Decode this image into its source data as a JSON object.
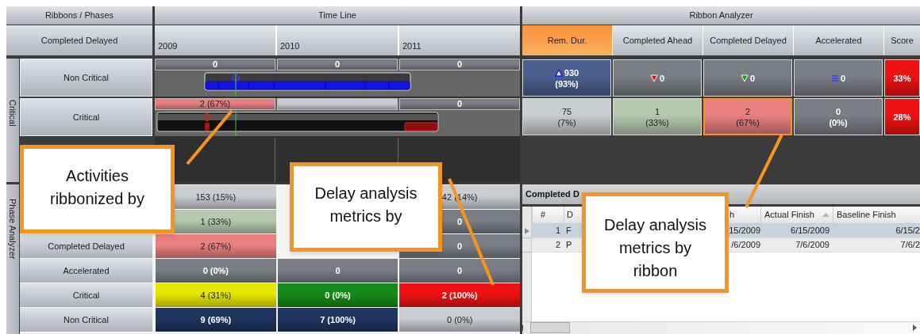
{
  "column_headers": {
    "ribbons_phases": "Ribbons / Phases",
    "time_line": "Time Line",
    "ribbon_analyzer": "Ribbon Analyzer"
  },
  "metric": "Completed Delayed",
  "years": [
    "2009",
    "2010",
    "2011"
  ],
  "analyzer_columns": [
    {
      "label": "Rem. Dur.",
      "selected": true
    },
    {
      "label": "Completed Ahead",
      "selected": false
    },
    {
      "label": "Completed Delayed",
      "selected": false
    },
    {
      "label": "Accelerated",
      "selected": false
    },
    {
      "label": "Score",
      "selected": false
    }
  ],
  "ribbon_group": "Critical",
  "ribbons": [
    {
      "label": "Non Critical",
      "kind": "noncritical",
      "periods": [
        {
          "text": "0",
          "color": "#7a7d84"
        },
        {
          "text": "0",
          "color": "#7a7d84"
        },
        {
          "text": "0",
          "color": "#7a7d84"
        }
      ],
      "metrics": [
        {
          "kind": "up",
          "value": "930",
          "share": "(93%)",
          "color": "#4a5f8e",
          "selected": false
        },
        {
          "kind": "down",
          "value": "0",
          "color": "#7a7d84",
          "selected": false
        },
        {
          "kind": "downgreen",
          "value": "0",
          "color": "#7a7d84",
          "selected": false
        },
        {
          "kind": "equal",
          "value": "0",
          "color": "#7a7d84",
          "selected": false
        },
        {
          "kind": "plain",
          "value": "33%",
          "color": "#ee1111",
          "selected": false
        }
      ]
    },
    {
      "label": "Critical",
      "kind": "critical",
      "periods": [
        {
          "text": "2 (67%)",
          "color": "#e88080"
        },
        {
          "color": "#c9ccd1"
        },
        {
          "text": "0",
          "color": "#7a7d84"
        }
      ],
      "metrics": [
        {
          "kind": "plain",
          "value": "75",
          "share": "(7%)",
          "color": "#c9ccd1",
          "selected": false
        },
        {
          "kind": "plain",
          "value": "1",
          "share": "(33%)",
          "color": "#b5c9ae",
          "selected": false
        },
        {
          "kind": "plain",
          "value": "2",
          "share": "(67%)",
          "color": "#e88080",
          "selected": true
        },
        {
          "kind": "plain",
          "value": "0",
          "share": "(0%)",
          "color": "#7a7d84",
          "selected": false
        },
        {
          "kind": "plain",
          "value": "28%",
          "color": "#ee1111",
          "selected": false
        }
      ]
    }
  ],
  "phase_analyzer": {
    "title": "Phase Analyzer",
    "rows": [
      {
        "cells": [
          {
            "text": "153 (15%)",
            "color": "#c9ccd1"
          },
          null,
          {
            "text": "42 (14%)",
            "color": "#c9ccd1"
          }
        ]
      },
      {
        "cells": [
          {
            "text": "1 (33%)",
            "color": "#b5c9ae"
          },
          null,
          {
            "text": "0",
            "color": "#7a7d84"
          }
        ]
      },
      {
        "label": "Completed Delayed",
        "cells": [
          {
            "text": "2 (67%)",
            "color": "#e88080"
          },
          null,
          {
            "text": "0",
            "color": "#7a7d84"
          }
        ]
      },
      {
        "label": "Accelerated",
        "cells": [
          {
            "text": "0 (0%)",
            "color": "#7a7d84"
          },
          {
            "text": "0",
            "color": "#7a7d84"
          },
          {
            "text": "0",
            "color": "#7a7d84"
          }
        ]
      },
      {
        "label": "Critical",
        "cells": [
          {
            "text": "4 (31%)",
            "color": "#e6e600"
          },
          {
            "text": "0 (0%)",
            "color": "#168a16"
          },
          {
            "text": "2 (100%)",
            "color": "#ee1111"
          }
        ]
      },
      {
        "label": "Non Critical",
        "cells": [
          {
            "text": "9 (69%)",
            "color": "#1f355f"
          },
          {
            "text": "7 (100%)",
            "color": "#1f355f"
          },
          {
            "text": "0 (0%)",
            "color": "#c9ccd1"
          }
        ]
      }
    ]
  },
  "details_panel": {
    "title": "Completed D",
    "columns": [
      {
        "label": "#",
        "sorted": false
      },
      {
        "label": "D"
      },
      {
        "label": "h"
      },
      {
        "label": "Actual Finish",
        "sorted": true
      },
      {
        "label": "Baseline Finish",
        "sorted": false
      }
    ],
    "rows": [
      {
        "selected": true,
        "cells": [
          "1",
          "F",
          "15/2009",
          "6/15/2009",
          "6/15/2"
        ]
      },
      {
        "selected": false,
        "cells": [
          "2",
          "P",
          "/6/2009",
          "7/6/2009",
          "7/6/2"
        ]
      }
    ]
  },
  "callouts": [
    {
      "text": "Activities ribbonized by"
    },
    {
      "text": "Delay analysis metrics by"
    },
    {
      "text": "Delay analysis metrics by ribbon"
    }
  ]
}
